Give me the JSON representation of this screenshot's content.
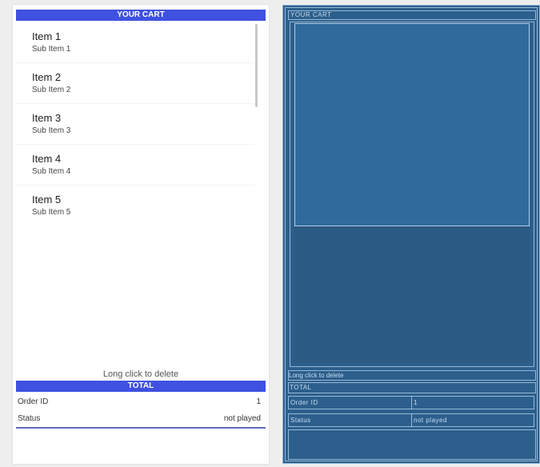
{
  "preview": {
    "cart_title": "YOUR CART",
    "items": [
      {
        "title": "Item 1",
        "sub": "Sub Item 1"
      },
      {
        "title": "Item 2",
        "sub": "Sub Item 2"
      },
      {
        "title": "Item 3",
        "sub": "Sub Item 3"
      },
      {
        "title": "Item 4",
        "sub": "Sub Item 4"
      },
      {
        "title": "Item 5",
        "sub": "Sub Item 5"
      }
    ],
    "hint": "Long click to delete",
    "total_title": "TOTAL",
    "order_id_label": "Order ID",
    "order_id_value": "1",
    "status_label": "Status",
    "status_value": "not played"
  },
  "blueprint": {
    "cart_title": "YOUR CART",
    "hint": "Long click to delete",
    "total_title": "TOTAL",
    "order_id_label": "Order ID",
    "order_id_value": "1",
    "status_label": "Status",
    "status_value": "not played"
  },
  "colors": {
    "accent": "#3f51e0",
    "underline": "#5c6bc0",
    "blueprint_bg": "#2c5f8c",
    "blueprint_line": "#c9dcef"
  }
}
